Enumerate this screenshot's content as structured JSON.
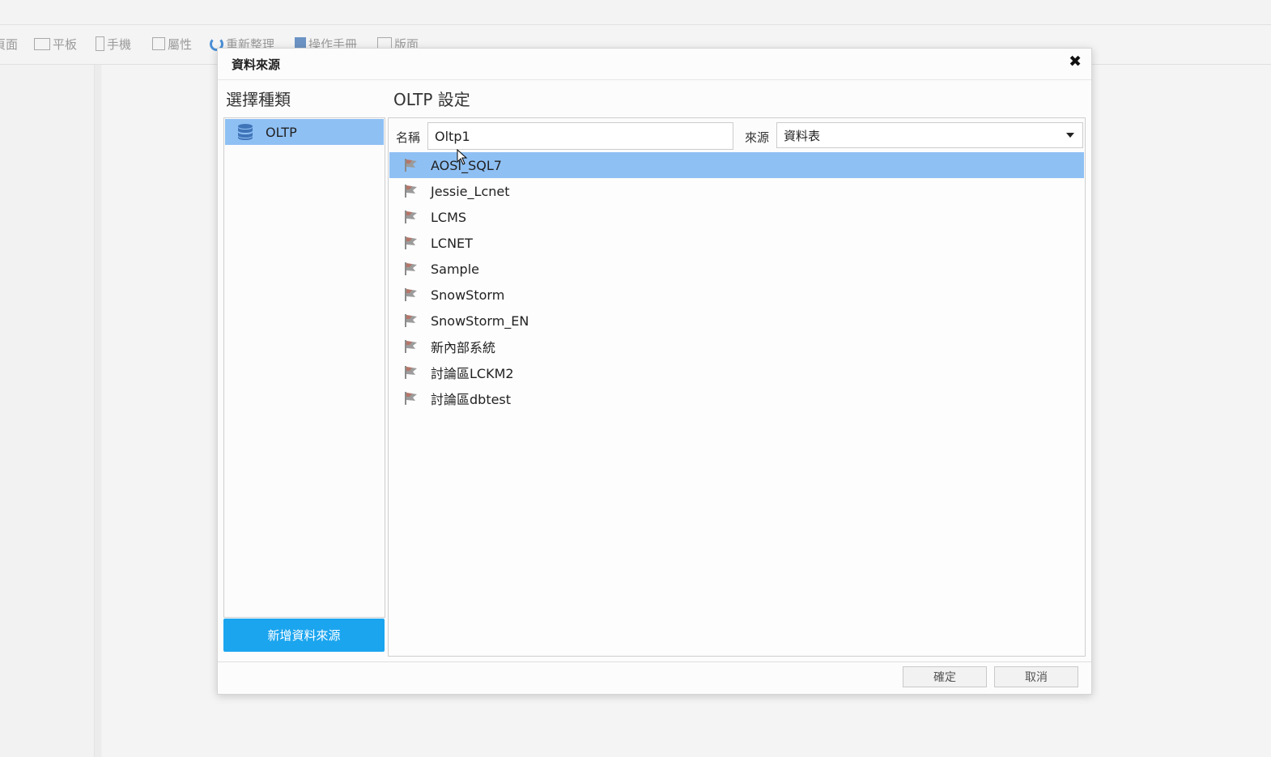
{
  "toolbar": {
    "items": [
      {
        "label": "頁面",
        "icon": "page-icon"
      },
      {
        "label": "平板",
        "icon": "tablet-icon"
      },
      {
        "label": "手機",
        "icon": "phone-icon"
      },
      {
        "label": "屬性",
        "icon": "properties-icon"
      },
      {
        "label": "重新整理",
        "icon": "refresh-icon"
      },
      {
        "label": "操作手冊",
        "icon": "manual-icon"
      },
      {
        "label": "版面",
        "icon": "layout-icon"
      }
    ]
  },
  "dialog": {
    "title": "資料來源",
    "close_glyph": "✖",
    "left_heading": "選擇種類",
    "right_heading": "OLTP 設定",
    "types": [
      {
        "label": "OLTP",
        "icon": "database-icon",
        "selected": true
      }
    ],
    "add_button": "新增資料來源",
    "name_label": "名稱",
    "name_value": "Oltp1",
    "source_label": "來源",
    "source_value": "資料表",
    "list": [
      {
        "label": "AOSI_SQL7",
        "selected": true
      },
      {
        "label": "Jessie_Lcnet",
        "selected": false
      },
      {
        "label": "LCMS",
        "selected": false
      },
      {
        "label": "LCNET",
        "selected": false
      },
      {
        "label": "Sample",
        "selected": false
      },
      {
        "label": "SnowStorm",
        "selected": false
      },
      {
        "label": "SnowStorm_EN",
        "selected": false
      },
      {
        "label": "新內部系統",
        "selected": false
      },
      {
        "label": "討論區LCKM2",
        "selected": false
      },
      {
        "label": "討論區dbtest",
        "selected": false
      }
    ],
    "ok_button": "確定",
    "cancel_button": "取消"
  },
  "colors": {
    "selection": "#8fc0f4",
    "primary_button": "#1ba5ef"
  }
}
